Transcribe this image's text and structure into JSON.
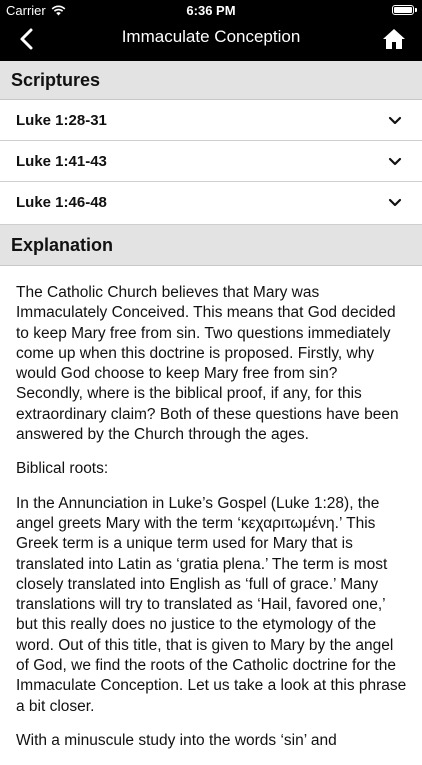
{
  "status_bar": {
    "carrier": "Carrier",
    "time": "6:36 PM"
  },
  "nav": {
    "title": "Immaculate Conception",
    "back_icon": "chevron-left-icon",
    "home_icon": "home-icon"
  },
  "scriptures": {
    "header": "Scriptures",
    "items": [
      {
        "label": "Luke 1:28-31"
      },
      {
        "label": "Luke 1:41-43"
      },
      {
        "label": "Luke 1:46-48"
      }
    ]
  },
  "explanation": {
    "header": "Explanation",
    "paragraphs": [
      "The Catholic Church believes that Mary was Immaculately Conceived. This means that God decided to keep Mary free from sin. Two questions immediately come up when this doctrine is proposed. Firstly, why would God choose to keep Mary free from sin? Secondly, where is the biblical proof, if any, for this extraordinary claim? Both of these questions have been answered by the Church through the ages.",
      "Biblical roots:",
      "In the Annunciation in Luke’s Gospel (Luke 1:28), the angel greets Mary with the term ‘κεχαριτωμένη.’ This Greek term is a unique term used for Mary that is translated into Latin as ‘gratia plena.’ The term is most closely translated into English as ‘full of grace.’ Many translations will try to translated as ‘Hail, favored one,’ but this really does no justice to the etymology of the word. Out of this title, that is given to Mary by the angel of God, we find the roots of the Catholic doctrine for the Immaculate Conception. Let us take a look at this phrase a bit closer.",
      "With a minuscule study into the words ‘sin’ and"
    ]
  }
}
